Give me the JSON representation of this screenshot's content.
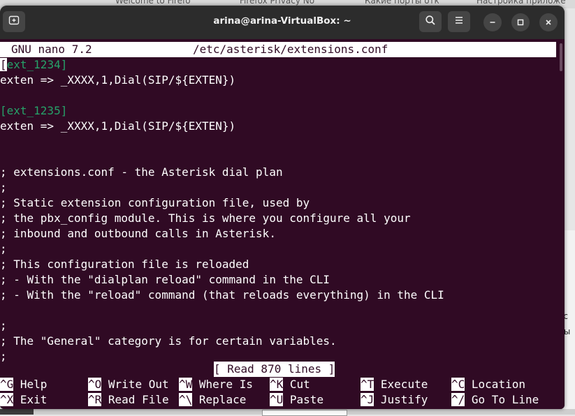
{
  "background": {
    "tabs": [
      "Welcome to Firefo",
      "Firefox Privacy No",
      "Какие порты отк",
      "Настройка приложе"
    ],
    "right_fragments": [
      "ос",
      "ны"
    ]
  },
  "window": {
    "title": "arina@arina-VirtualBox: ~",
    "icons": {
      "new_tab": "terminal-new-tab-icon",
      "search": "search-icon",
      "menu": "hamburger-menu-icon",
      "minimize": "minimize-icon",
      "maximize": "maximize-icon",
      "close": "close-icon"
    }
  },
  "nano": {
    "version": "GNU nano 7.2",
    "filename": "/etc/asterisk/extensions.conf",
    "lines": [
      {
        "type": "section",
        "cursor": "[",
        "text": "ext_1234]"
      },
      {
        "type": "text",
        "text": "exten => _XXXX,1,Dial(SIP/${EXTEN})"
      },
      {
        "type": "text",
        "text": ""
      },
      {
        "type": "section",
        "cursor": "",
        "text": "[ext_1235]"
      },
      {
        "type": "text",
        "text": "exten => _XXXX,1,Dial(SIP/${EXTEN})"
      },
      {
        "type": "text",
        "text": ""
      },
      {
        "type": "text",
        "text": ""
      },
      {
        "type": "text",
        "text": "; extensions.conf - the Asterisk dial plan"
      },
      {
        "type": "text",
        "text": ";"
      },
      {
        "type": "text",
        "text": "; Static extension configuration file, used by"
      },
      {
        "type": "text",
        "text": "; the pbx_config module. This is where you configure all your"
      },
      {
        "type": "text",
        "text": "; inbound and outbound calls in Asterisk."
      },
      {
        "type": "text",
        "text": ";"
      },
      {
        "type": "text",
        "text": "; This configuration file is reloaded"
      },
      {
        "type": "text",
        "text": "; - With the \"dialplan reload\" command in the CLI"
      },
      {
        "type": "text",
        "text": "; - With the \"reload\" command (that reloads everything) in the CLI"
      },
      {
        "type": "text",
        "text": ""
      },
      {
        "type": "text",
        "text": ";"
      },
      {
        "type": "text",
        "text": "; The \"General\" category is for certain variables."
      },
      {
        "type": "text",
        "text": ";"
      }
    ],
    "status": "[ Read 870 lines ]",
    "shortcuts": [
      [
        {
          "key": "^G",
          "label": "Help"
        },
        {
          "key": "^O",
          "label": "Write Out"
        },
        {
          "key": "^W",
          "label": "Where Is"
        },
        {
          "key": "^K",
          "label": "Cut"
        },
        {
          "key": "^T",
          "label": "Execute"
        },
        {
          "key": "^C",
          "label": "Location"
        }
      ],
      [
        {
          "key": "^X",
          "label": "Exit"
        },
        {
          "key": "^R",
          "label": "Read File"
        },
        {
          "key": "^\\",
          "label": "Replace"
        },
        {
          "key": "^U",
          "label": "Paste"
        },
        {
          "key": "^J",
          "label": "Justify"
        },
        {
          "key": "^/",
          "label": "Go To Line"
        }
      ]
    ]
  },
  "colors": {
    "terminal_bg": "#300a24",
    "section_header": "#26a269",
    "text": "#ffffff",
    "titlebar": "#2c2c2c"
  }
}
